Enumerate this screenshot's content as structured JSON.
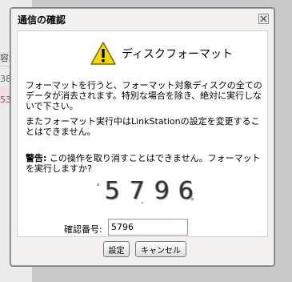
{
  "background": {
    "header_fragment": "容量",
    "row_fragments": [
      "38",
      "53"
    ]
  },
  "dialog": {
    "title": "通信の確認",
    "close_icon": "close-icon",
    "heading": "ディスクフォーマット",
    "warning_icon": "warning-icon",
    "paragraph1": "フォーマットを行うと、フォーマット対象ディスクの全てのデータが消去されます。特別な場合を除き、絶対に実行しないで下さい。",
    "paragraph2": "またフォーマット実行中はLinkStationの設定を変更することはできません。",
    "warning_label": "警告:",
    "warning_text": " この操作を取り消すことはできません。フォーマットを実行しますか?",
    "captcha_digits": [
      "5",
      "7",
      "9",
      "6"
    ],
    "confirm_label": "確認番号:",
    "confirm_value": "5796",
    "ok_label": "設定",
    "cancel_label": "キャンセル"
  }
}
